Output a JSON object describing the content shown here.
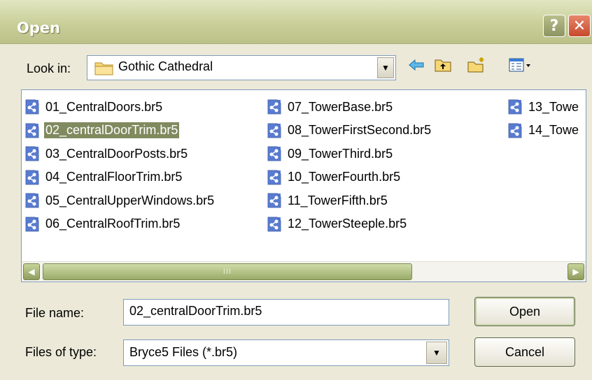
{
  "window": {
    "title": "Open",
    "help_glyph": "?",
    "close_glyph": "✕"
  },
  "look_in": {
    "label": "Look in:",
    "value": "Gothic Cathedral",
    "icon": "folder-icon"
  },
  "toolbar": {
    "back_icon": "back-arrow-icon",
    "up_icon": "up-folder-icon",
    "new_folder_icon": "new-folder-icon",
    "view_icon": "view-menu-icon"
  },
  "files": [
    {
      "name": "01_CentralDoors.br5",
      "selected": false
    },
    {
      "name": "02_centralDoorTrim.br5",
      "selected": true
    },
    {
      "name": "03_CentralDoorPosts.br5",
      "selected": false
    },
    {
      "name": "04_CentralFloorTrim.br5",
      "selected": false
    },
    {
      "name": "05_CentralUpperWindows.br5",
      "selected": false
    },
    {
      "name": "06_CentralRoofTrim.br5",
      "selected": false
    },
    {
      "name": "07_TowerBase.br5",
      "selected": false
    },
    {
      "name": "08_TowerFirstSecond.br5",
      "selected": false
    },
    {
      "name": "09_TowerThird.br5",
      "selected": false
    },
    {
      "name": "10_TowerFourth.br5",
      "selected": false
    },
    {
      "name": "11_TowerFifth.br5",
      "selected": false
    },
    {
      "name": "12_TowerSteeple.br5",
      "selected": false
    },
    {
      "name": "13_Towe",
      "selected": false
    },
    {
      "name": "14_Towe",
      "selected": false
    }
  ],
  "scrollbar": {
    "thumb_grip": "III"
  },
  "file_name": {
    "label": "File name:",
    "value": "02_centralDoorTrim.br5"
  },
  "file_type": {
    "label": "Files of type:",
    "value": "Bryce5 Files (*.br5)"
  },
  "buttons": {
    "open": "Open",
    "cancel": "Cancel"
  },
  "colors": {
    "selection": "#808a5f",
    "titlebar": "#c9cf98",
    "close": "#c84a2b"
  }
}
